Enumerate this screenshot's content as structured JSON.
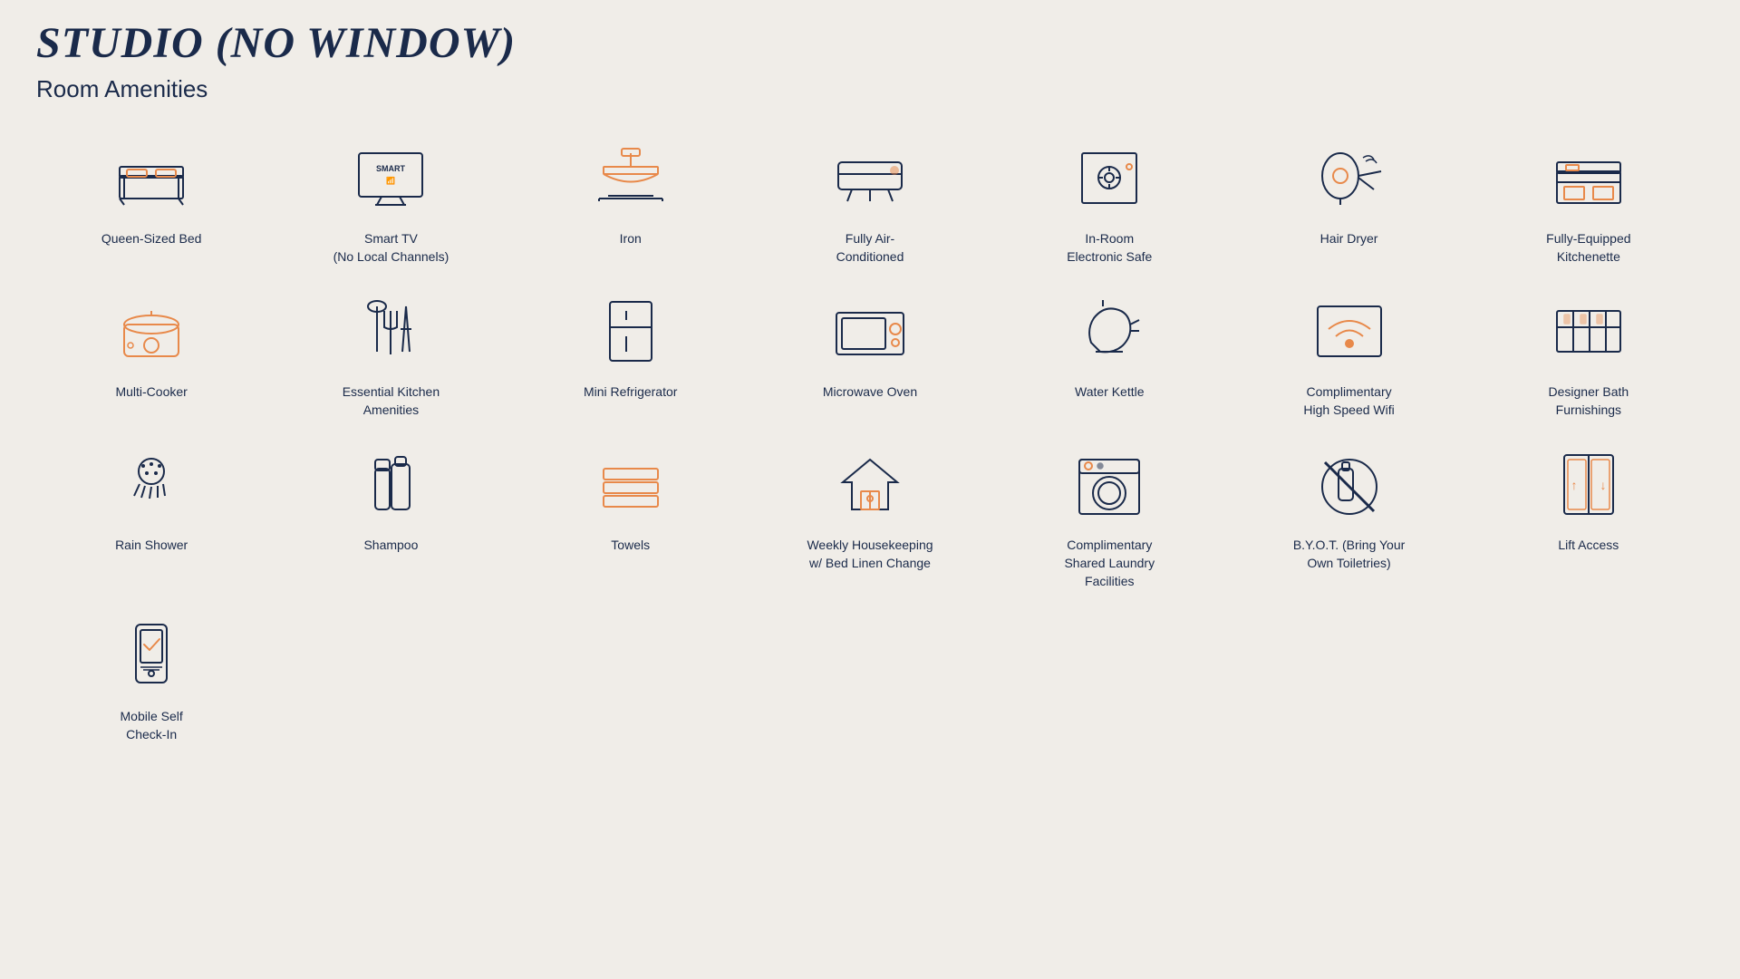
{
  "title": "STUDIO (NO WINDOW)",
  "subtitle": "Room Amenities",
  "amenities": [
    {
      "id": "queen-bed",
      "label": "Queen-Sized Bed",
      "icon": "bed"
    },
    {
      "id": "smart-tv",
      "label": "Smart TV\n(No Local Channels)",
      "icon": "tv"
    },
    {
      "id": "iron",
      "label": "Iron",
      "icon": "iron"
    },
    {
      "id": "air-conditioned",
      "label": "Fully Air-\nConditioned",
      "icon": "ac"
    },
    {
      "id": "safe",
      "label": "In-Room\nElectronic Safe",
      "icon": "safe"
    },
    {
      "id": "hair-dryer",
      "label": "Hair Dryer",
      "icon": "hairdryer"
    },
    {
      "id": "kitchenette",
      "label": "Fully-Equipped\nKitchenette",
      "icon": "kitchenette"
    },
    {
      "id": "multi-cooker",
      "label": "Multi-Cooker",
      "icon": "multicooker"
    },
    {
      "id": "kitchen-amenities",
      "label": "Essential Kitchen\nAmenities",
      "icon": "kitchenam"
    },
    {
      "id": "mini-fridge",
      "label": "Mini Refrigerator",
      "icon": "fridge"
    },
    {
      "id": "microwave",
      "label": "Microwave Oven",
      "icon": "microwave"
    },
    {
      "id": "water-kettle",
      "label": "Water Kettle",
      "icon": "kettle"
    },
    {
      "id": "wifi",
      "label": "Complimentary\nHigh Speed Wifi",
      "icon": "wifi"
    },
    {
      "id": "bath",
      "label": "Designer Bath\nFurnishings",
      "icon": "bath"
    },
    {
      "id": "rain-shower",
      "label": "Rain Shower",
      "icon": "shower"
    },
    {
      "id": "shampoo",
      "label": "Shampoo",
      "icon": "shampoo"
    },
    {
      "id": "towels",
      "label": "Towels",
      "icon": "towels"
    },
    {
      "id": "housekeeping",
      "label": "Weekly Housekeeping\nw/ Bed Linen Change",
      "icon": "housekeeping"
    },
    {
      "id": "laundry",
      "label": "Complimentary\nShared Laundry\nFacilities",
      "icon": "laundry"
    },
    {
      "id": "byot",
      "label": "B.Y.O.T. (Bring Your\nOwn Toiletries)",
      "icon": "byot"
    },
    {
      "id": "lift",
      "label": "Lift Access",
      "icon": "lift"
    },
    {
      "id": "checkin",
      "label": "Mobile Self\nCheck-In",
      "icon": "checkin"
    }
  ]
}
